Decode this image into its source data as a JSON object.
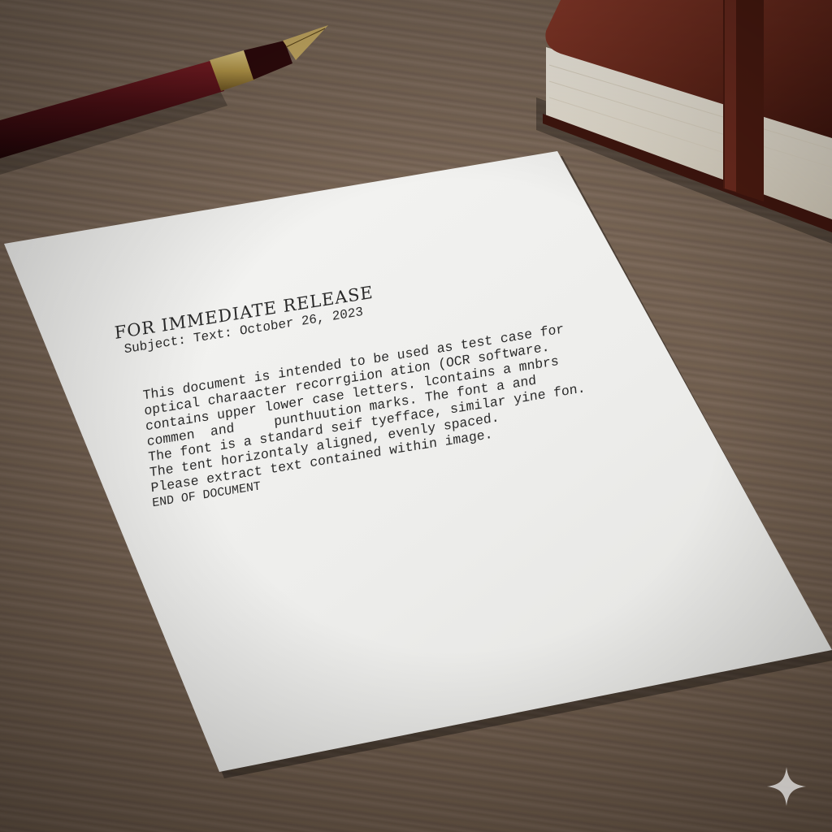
{
  "document": {
    "heading": "FOR IMMEDIATE RELEASE",
    "subject": "Subject: Text: October 26, 2023",
    "body_lines": [
      "This document is intended to be used as test case for",
      "optical charaacter recorrgiion ation (OCR software.",
      "contains upper lower case letters. lcontains a mnbrs",
      "commen  and     punthuution marks. The font a and",
      "The font is a standard seif tyefface, similar yine fon.",
      "The tent horizontaly aligned, evenly spaced.",
      "Please extract text contained within image."
    ],
    "end_marker": "END OF DOCUMENT"
  },
  "colors": {
    "table_wood": "#705d4d",
    "paper": "#f1f1ef",
    "ink": "#2a2a2a",
    "leather": "#6b2a1e",
    "pen_barrel": "#4a0f14",
    "pen_band": "#b89a4a"
  },
  "icons": {
    "pen": "fountain-pen-icon",
    "notebook": "leather-notebook-icon",
    "sparkle": "sparkle-icon"
  }
}
